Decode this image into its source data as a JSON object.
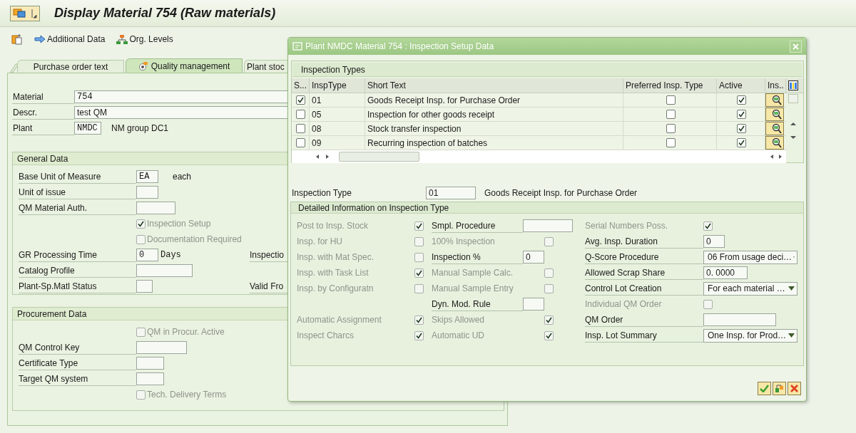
{
  "window": {
    "title": "Display Material 754 (Raw materials)"
  },
  "toolbar": [
    {
      "kind": "arrow",
      "label": "Additional Data"
    },
    {
      "kind": "org",
      "label": "Org. Levels"
    }
  ],
  "tabs": [
    {
      "label": "Purchase order text",
      "selected": false
    },
    {
      "label": "Quality management",
      "selected": true
    },
    {
      "label": "Plant stoc",
      "selected": false
    }
  ],
  "header_fields": [
    {
      "label": "Material",
      "value": "754"
    },
    {
      "label": "Descr.",
      "value": "test QM"
    },
    {
      "label": "Plant",
      "value": "NMDC",
      "description": "NM group DC1"
    }
  ],
  "general_data": {
    "title": "General Data",
    "rows": [
      {
        "kind": "field",
        "label": "Base Unit of Measure",
        "value": "EA",
        "unit": "each"
      },
      {
        "kind": "field",
        "label": "Unit of issue"
      },
      {
        "kind": "field",
        "label": "QM Material Auth."
      },
      {
        "kind": "checkbox",
        "label": "Inspection Setup",
        "checked": true,
        "disabled": true
      },
      {
        "kind": "checkbox",
        "label": "Documentation Required",
        "checked": false,
        "disabled": true
      },
      {
        "kind": "field",
        "label": "GR Processing Time",
        "value": "0",
        "unit": "Days",
        "side_label": "Inspectio"
      },
      {
        "kind": "field",
        "label": "Catalog Profile"
      },
      {
        "kind": "field",
        "label": "Plant-Sp.Matl Status",
        "side_label": "Valid Fro"
      }
    ]
  },
  "procurement_data": {
    "title": "Procurement Data",
    "rows": [
      {
        "kind": "checkbox",
        "label": "QM in Procur. Active",
        "checked": false,
        "disabled": true
      },
      {
        "kind": "field",
        "label": "QM Control Key"
      },
      {
        "kind": "field",
        "label": "Certificate Type"
      },
      {
        "kind": "field",
        "label": "Target QM system"
      },
      {
        "kind": "checkbox",
        "label": "Tech. Delivery Terms",
        "checked": false,
        "disabled": true
      }
    ]
  },
  "dialog": {
    "title": "Plant NMDC Material 754 : Inspection Setup Data",
    "table": {
      "title": "Inspection Types",
      "columns": [
        "S...",
        "InspType",
        "Short Text",
        "Preferred Insp. Type",
        "Active",
        "Ins.."
      ],
      "rows": [
        {
          "checked": true,
          "insp_type": "01",
          "short_text": "Goods Receipt Insp. for Purchase Order",
          "preferred": false,
          "active": true
        },
        {
          "checked": false,
          "insp_type": "05",
          "short_text": "Inspection for other goods receipt",
          "preferred": false,
          "active": true
        },
        {
          "checked": false,
          "insp_type": "08",
          "short_text": "Stock transfer inspection",
          "preferred": false,
          "active": true
        },
        {
          "checked": false,
          "insp_type": "09",
          "short_text": "Recurring inspection of batches",
          "preferred": false,
          "active": true
        }
      ]
    },
    "inspection_type": {
      "label": "Inspection Type",
      "value": "01",
      "description": "Goods Receipt Insp. for Purchase Order"
    },
    "details": {
      "title": "Detailed Information on Inspection Type",
      "columns": [
        [
          [
            {
              "kind": "checkbox",
              "label": "Post to Insp. Stock",
              "checked": true,
              "disabled": true
            },
            {
              "kind": "checkbox",
              "label": "Insp. for HU",
              "checked": false,
              "disabled": true
            },
            {
              "kind": "checkbox",
              "label": "Insp. with Mat Spec.",
              "checked": false,
              "disabled": true
            },
            {
              "kind": "checkbox",
              "label": "Insp. with Task List",
              "checked": true,
              "disabled": true
            },
            {
              "kind": "checkbox",
              "label": "Insp. by Configuratn",
              "checked": false,
              "disabled": true
            }
          ],
          [
            {
              "kind": "checkbox",
              "label": "Automatic Assignment",
              "checked": true,
              "disabled": true
            },
            {
              "kind": "checkbox",
              "label": "Inspect Charcs",
              "checked": true,
              "disabled": true
            }
          ]
        ],
        [
          [
            {
              "kind": "field",
              "label": "Smpl. Procedure",
              "disabled": false
            },
            {
              "kind": "checkbox",
              "label": "100% Inspection",
              "checked": false,
              "disabled": true
            },
            {
              "kind": "field",
              "label": "Inspection %",
              "value": "0",
              "disabled": false
            },
            {
              "kind": "checkbox",
              "label": "Manual Sample Calc.",
              "checked": false,
              "disabled": true
            },
            {
              "kind": "checkbox",
              "label": "Manual Sample Entry",
              "checked": false,
              "disabled": true
            },
            {
              "kind": "field",
              "label": "Dyn. Mod. Rule",
              "disabled": false
            },
            {
              "kind": "checkbox",
              "label": "Skips Allowed",
              "checked": true,
              "disabled": true
            },
            {
              "kind": "checkbox",
              "label": "Automatic UD",
              "checked": true,
              "disabled": true
            }
          ]
        ],
        [
          [
            {
              "kind": "checkbox",
              "label": "Serial Numbers Poss.",
              "checked": true,
              "disabled": true
            },
            {
              "kind": "field",
              "label": "Avg. Insp. Duration",
              "value": "0",
              "disabled": false
            },
            {
              "kind": "dropdown",
              "label": "Q-Score Procedure",
              "value": "06 From usage deci…",
              "disabled": false
            },
            {
              "kind": "field",
              "label": "Allowed Scrap Share",
              "value": "0. 0000",
              "disabled": false
            },
            {
              "kind": "dropdown",
              "label": "Control Lot Creation",
              "value": "For each material …",
              "disabled": false
            },
            {
              "kind": "checkbox",
              "label": "Individual QM Order",
              "checked": false,
              "disabled": true
            },
            {
              "kind": "field",
              "label": "QM Order",
              "disabled": false
            },
            {
              "kind": "dropdown",
              "label": "Insp. Lot Summary",
              "value": "One Insp. for Prod…",
              "disabled": false
            }
          ]
        ]
      ]
    }
  }
}
